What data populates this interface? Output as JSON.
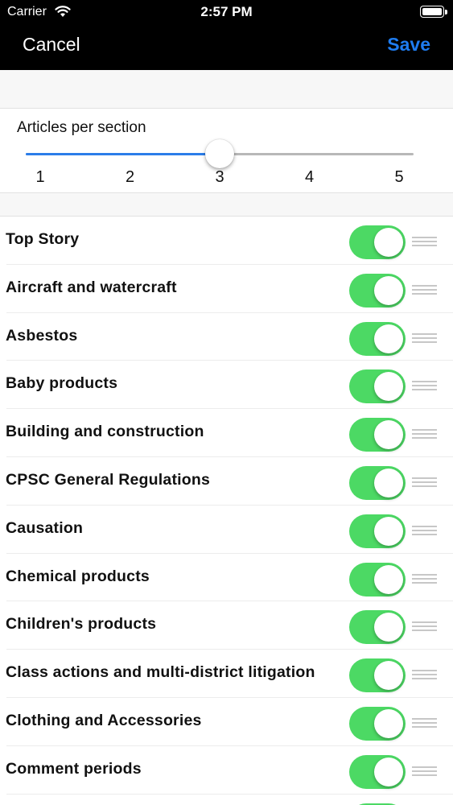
{
  "status_bar": {
    "carrier": "Carrier",
    "time": "2:57 PM",
    "wifi_icon": "wifi-icon",
    "battery_icon": "battery-icon"
  },
  "nav": {
    "cancel_label": "Cancel",
    "save_label": "Save",
    "save_color": "#1e7cf0"
  },
  "slider": {
    "label": "Articles per section",
    "min": 1,
    "max": 5,
    "value": 3,
    "ticks": [
      "1",
      "2",
      "3",
      "4",
      "5"
    ],
    "track_color": "#b8b8b8",
    "fill_color": "#2b7de9"
  },
  "sections": {
    "toggle_on_color": "#4cd964",
    "grip_icon": "reorder-handle-icon",
    "items": [
      {
        "label": "Top Story",
        "enabled": true
      },
      {
        "label": "Aircraft and watercraft",
        "enabled": true
      },
      {
        "label": "Asbestos",
        "enabled": true
      },
      {
        "label": "Baby products",
        "enabled": true
      },
      {
        "label": "Building and construction",
        "enabled": true
      },
      {
        "label": "CPSC General Regulations",
        "enabled": true
      },
      {
        "label": "Causation",
        "enabled": true
      },
      {
        "label": "Chemical products",
        "enabled": true
      },
      {
        "label": "Children's products",
        "enabled": true
      },
      {
        "label": "Class actions and multi-district litigation",
        "enabled": true
      },
      {
        "label": "Clothing and Accessories",
        "enabled": true
      },
      {
        "label": "Comment periods",
        "enabled": true
      },
      {
        "label": "",
        "enabled": true
      }
    ]
  }
}
